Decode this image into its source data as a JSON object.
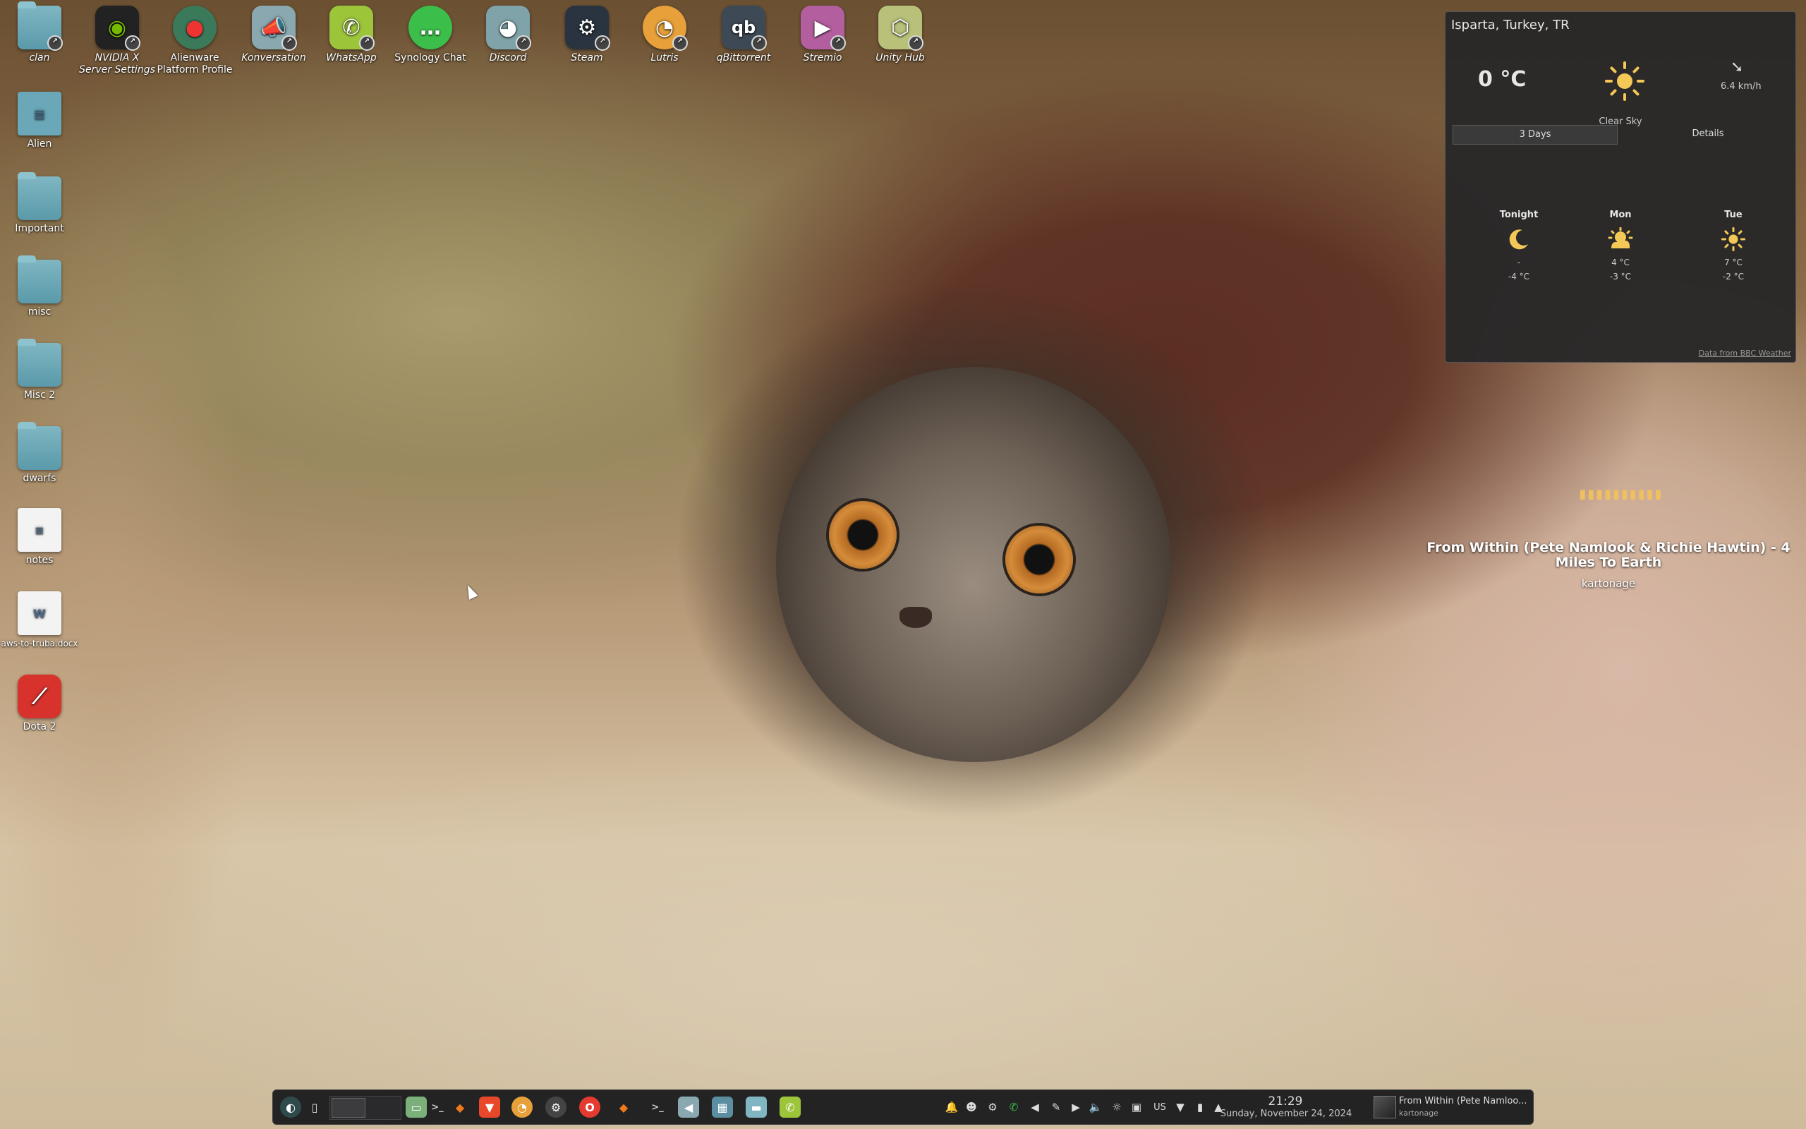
{
  "desktop": {
    "top_icons": [
      {
        "label": "clan",
        "icon": "folder-link-icon",
        "italic": true
      },
      {
        "label": "NVIDIA X Server Settings",
        "icon": "nvidia-icon",
        "italic": true
      },
      {
        "label": "Alienware Platform Profile",
        "icon": "alienware-icon",
        "italic": false
      },
      {
        "label": "Konversation",
        "icon": "konversation-icon",
        "italic": true
      },
      {
        "label": "WhatsApp",
        "icon": "whatsapp-icon",
        "italic": true
      },
      {
        "label": "Synology Chat",
        "icon": "synology-chat-icon",
        "italic": false
      },
      {
        "label": "Discord",
        "icon": "discord-icon",
        "italic": true
      },
      {
        "label": "Steam",
        "icon": "steam-icon",
        "italic": true
      },
      {
        "label": "Lutris",
        "icon": "lutris-icon",
        "italic": true
      },
      {
        "label": "qBittorrent",
        "icon": "qbittorrent-icon",
        "italic": true
      },
      {
        "label": "Stremio",
        "icon": "stremio-icon",
        "italic": true
      },
      {
        "label": "Unity Hub",
        "icon": "unity-hub-icon",
        "italic": true
      }
    ],
    "left_icons": [
      {
        "label": "Alien",
        "icon": "folder-icon"
      },
      {
        "label": "Important",
        "icon": "folder-icon"
      },
      {
        "label": "misc",
        "icon": "folder-icon"
      },
      {
        "label": "Misc 2",
        "icon": "folder-icon"
      },
      {
        "label": "dwarfs",
        "icon": "folder-icon"
      },
      {
        "label": "notes",
        "icon": "text-document-icon"
      },
      {
        "label": "aws-to-truba.docx",
        "icon": "docx-document-icon"
      },
      {
        "label": "Dota 2",
        "icon": "dota2-icon"
      }
    ]
  },
  "weather": {
    "location": "Isparta, Turkey, TR",
    "temperature": "0 °C",
    "wind": "6.4 km/h",
    "condition": "Clear Sky",
    "tab_forecast": "3 Days",
    "tab_details": "Details",
    "days": [
      {
        "name": "Tonight",
        "icon": "moon-icon",
        "high": "-",
        "low": "-4 °C"
      },
      {
        "name": "Mon",
        "icon": "partly-cloudy-icon",
        "high": "4 °C",
        "low": "-3 °C"
      },
      {
        "name": "Tue",
        "icon": "sun-icon",
        "high": "7 °C",
        "low": "-2 °C"
      }
    ],
    "credit": "Data from BBC Weather"
  },
  "now_playing": {
    "title": "From Within (Pete Namlook & Richie Hawtin) - 4 Miles To Earth",
    "artist": "kartonage"
  },
  "taskbar": {
    "tray_language": "US",
    "time": "21:29",
    "date": "Sunday, November 24, 2024",
    "media_title": "From Within (Pete Namloo...",
    "media_artist": "kartonage"
  },
  "colors": {
    "weather_bg": "#282828",
    "taskbar_bg": "#1c1c1e",
    "accent": "#f0c060"
  }
}
